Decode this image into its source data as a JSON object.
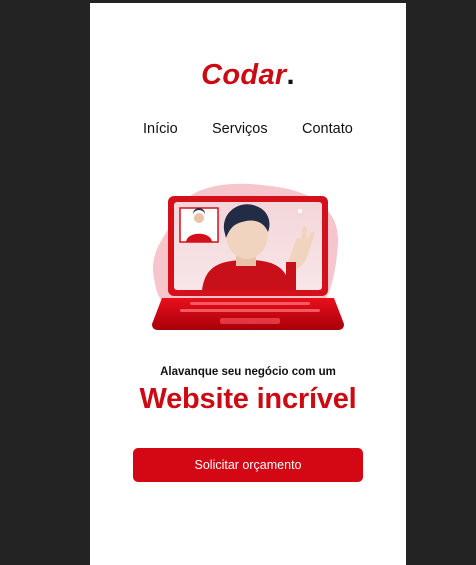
{
  "brand": {
    "name": "Codar",
    "dot": "."
  },
  "nav": {
    "items": [
      {
        "label": "Início"
      },
      {
        "label": "Serviços"
      },
      {
        "label": "Contato"
      }
    ]
  },
  "hero": {
    "tagline": "Alavanque seu negócio com um",
    "headline": "Website incrível",
    "cta_label": "Solicitar orçamento",
    "illustration": "video-call-laptop-icon"
  },
  "colors": {
    "accent": "#cc0a14",
    "button": "#d30814",
    "background": "#232323",
    "page": "#ffffff"
  }
}
